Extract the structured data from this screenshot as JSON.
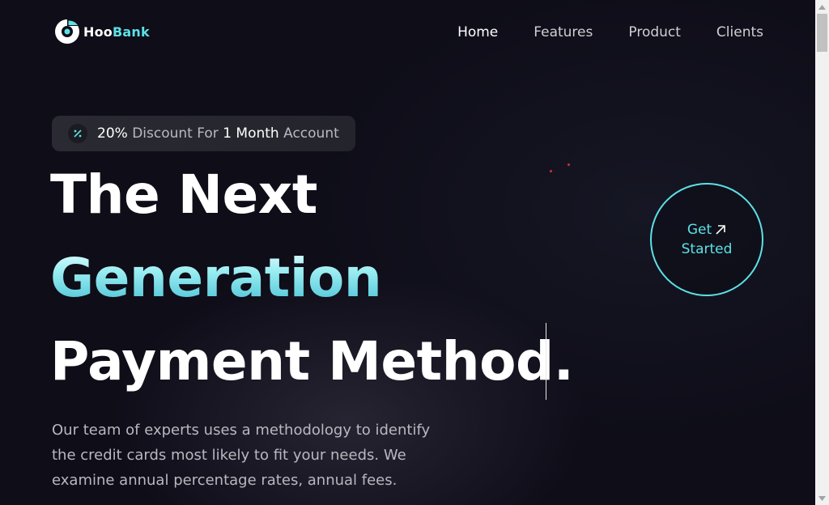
{
  "nav": {
    "logo_part1": "Hoo",
    "logo_part2": "Bank",
    "items": [
      {
        "label": "Home",
        "active": true
      },
      {
        "label": "Features",
        "active": false
      },
      {
        "label": "Product",
        "active": false
      },
      {
        "label": "Clients",
        "active": false
      }
    ]
  },
  "discount": {
    "icon": "percent-icon",
    "percent": "20%",
    "middle": " Discount For ",
    "duration": "1 Month",
    "suffix": " Account"
  },
  "hero": {
    "line1": "The Next",
    "line2": "Generation",
    "line3": "Payment Method.",
    "description": "Our team of experts uses a methodology to identify the credit cards most likely to fit your needs. We examine annual percentage rates, annual fees."
  },
  "cta": {
    "line1": "Get",
    "line2": "Started",
    "icon": "arrow-up-right-icon"
  },
  "colors": {
    "accent": "#5ce1e6",
    "background": "#0e0d18",
    "text_muted": "#b8b8bf"
  }
}
